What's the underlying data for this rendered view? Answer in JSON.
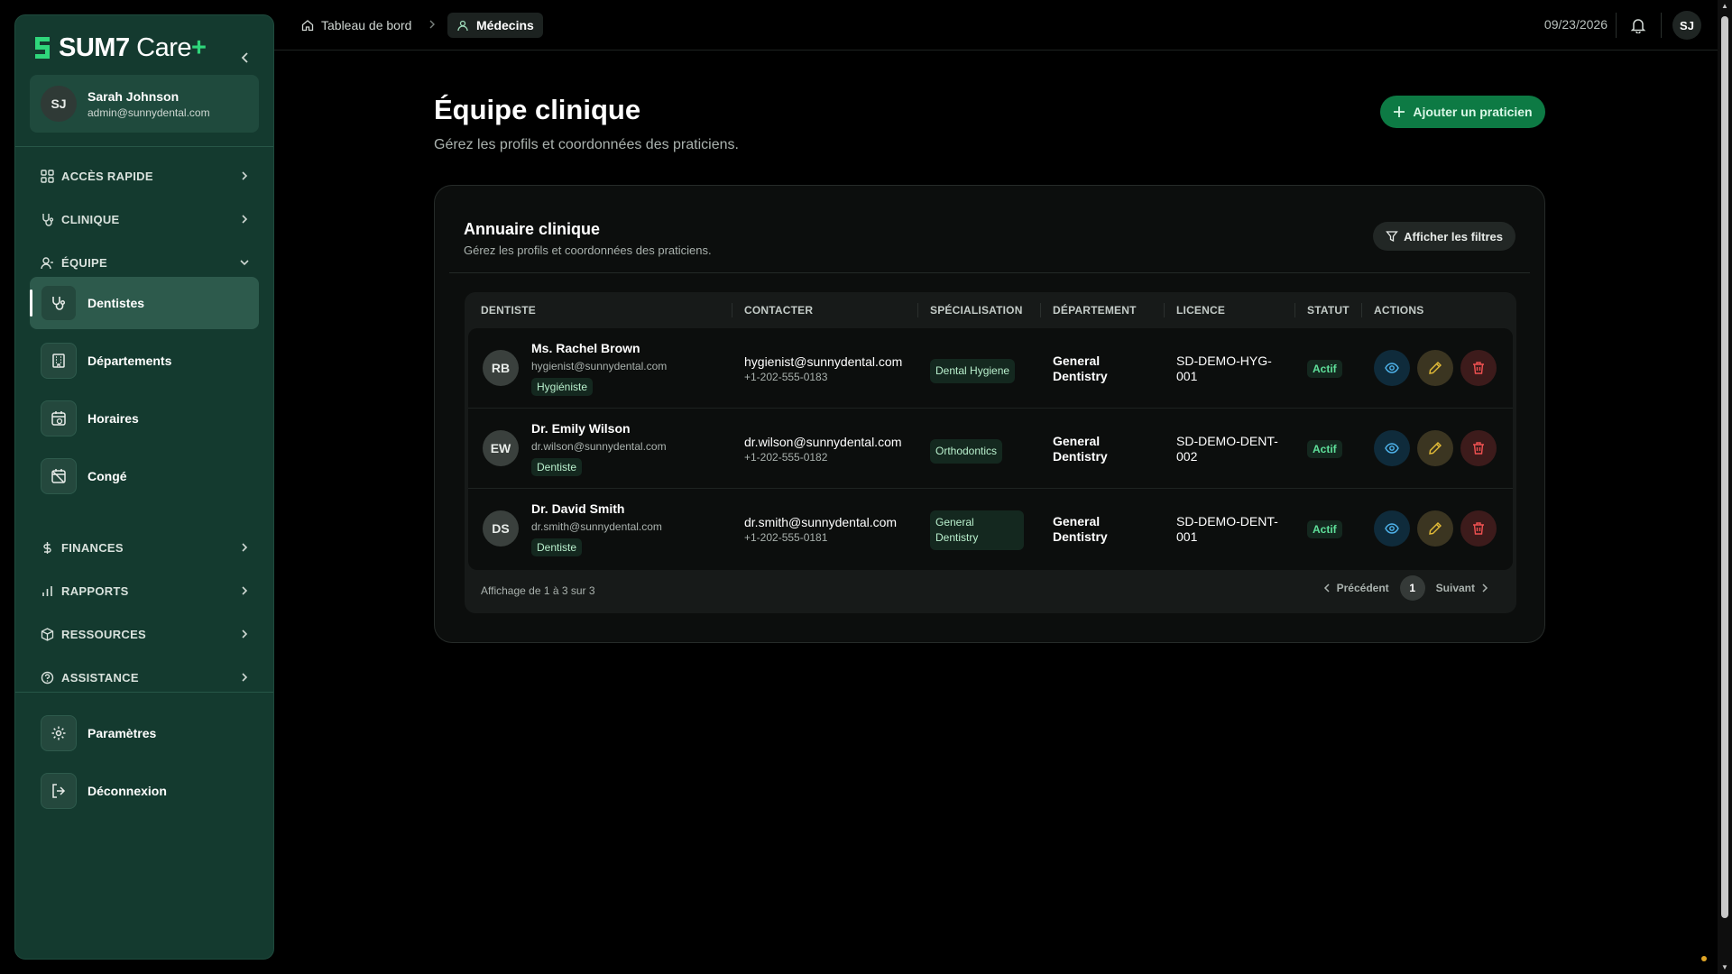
{
  "brand": {
    "name": "SUM7",
    "product": "Care",
    "plus": "+"
  },
  "user": {
    "initials": "SJ",
    "name": "Sarah Johnson",
    "email": "admin@sunnydental.com"
  },
  "nav": {
    "quick_access": "ACCÈS RAPIDE",
    "clinic": "CLINIQUE",
    "team": "ÉQUIPE",
    "team_items": [
      "Dentistes",
      "Départements",
      "Horaires",
      "Congé"
    ],
    "finances": "FINANCES",
    "reports": "RAPPORTS",
    "resources": "RESSOURCES",
    "support": "ASSISTANCE",
    "settings": "Paramètres",
    "logout": "Déconnexion"
  },
  "breadcrumb": {
    "home": "Tableau de bord",
    "current": "Médecins"
  },
  "topbar": {
    "date": "09/23/2026",
    "avatar": "SJ"
  },
  "page": {
    "title": "Équipe clinique",
    "subtitle": "Gérez les profils et coordonnées des praticiens.",
    "add_button": "Ajouter un praticien"
  },
  "directory": {
    "title": "Annuaire clinique",
    "subtitle": "Gérez les profils et coordonnées des praticiens.",
    "filter_button": "Afficher les filtres",
    "columns": [
      "DENTISTE",
      "CONTACTER",
      "SPÉCIALISATION",
      "DÉPARTEMENT",
      "LICENCE",
      "STATUT",
      "ACTIONS"
    ],
    "rows": [
      {
        "initials": "RB",
        "name": "Ms. Rachel Brown",
        "email": "hygienist@sunnydental.com",
        "role": "Hygiéniste",
        "contact_email": "hygienist@sunnydental.com",
        "phone": "+1-202-555-0183",
        "specialization": "Dental Hygiene",
        "department": "General Dentistry",
        "license": "SD-DEMO-HYG-001",
        "status": "Actif"
      },
      {
        "initials": "EW",
        "name": "Dr. Emily Wilson",
        "email": "dr.wilson@sunnydental.com",
        "role": "Dentiste",
        "contact_email": "dr.wilson@sunnydental.com",
        "phone": "+1-202-555-0182",
        "specialization": "Orthodontics",
        "department": "General Dentistry",
        "license": "SD-DEMO-DENT-002",
        "status": "Actif"
      },
      {
        "initials": "DS",
        "name": "Dr. David Smith",
        "email": "dr.smith@sunnydental.com",
        "role": "Dentiste",
        "contact_email": "dr.smith@sunnydental.com",
        "phone": "+1-202-555-0181",
        "specialization": "General Dentistry",
        "department": "General Dentistry",
        "license": "SD-DEMO-DENT-001",
        "status": "Actif"
      }
    ],
    "footer": "Affichage de 1 à 3 sur 3",
    "prev": "Précédent",
    "page": "1",
    "next": "Suivant"
  }
}
